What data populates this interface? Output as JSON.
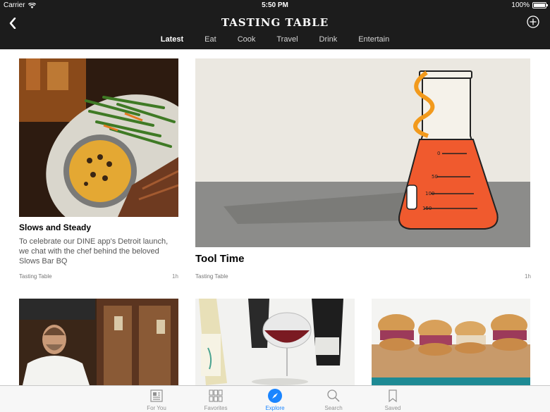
{
  "status": {
    "carrier": "Carrier",
    "time": "5:50 PM",
    "battery": "100%"
  },
  "brand": "TASTING TABLE",
  "tabs": [
    "Latest",
    "Eat",
    "Cook",
    "Travel",
    "Drink",
    "Entertain"
  ],
  "articles": [
    {
      "title": "Slows and Steady",
      "desc": "To celebrate our DINE app's Detroit launch, we chat with the chef behind the beloved Slows Bar BQ",
      "source": "Tasting Table",
      "time": "1h"
    },
    {
      "title": "Tool Time",
      "source": "Tasting Table",
      "time": "1h",
      "flask_marks": [
        "0",
        "50",
        "100",
        "150"
      ]
    }
  ],
  "tabbar": [
    {
      "label": "For You",
      "icon": "news-icon"
    },
    {
      "label": "Favorites",
      "icon": "grid-icon"
    },
    {
      "label": "Explore",
      "icon": "compass-icon"
    },
    {
      "label": "Search",
      "icon": "search-icon"
    },
    {
      "label": "Saved",
      "icon": "bookmark-icon"
    }
  ],
  "colors": {
    "accent": "#1a85ff",
    "bar": "#1c1c1c",
    "flask_liquid": "#f05a2e"
  }
}
